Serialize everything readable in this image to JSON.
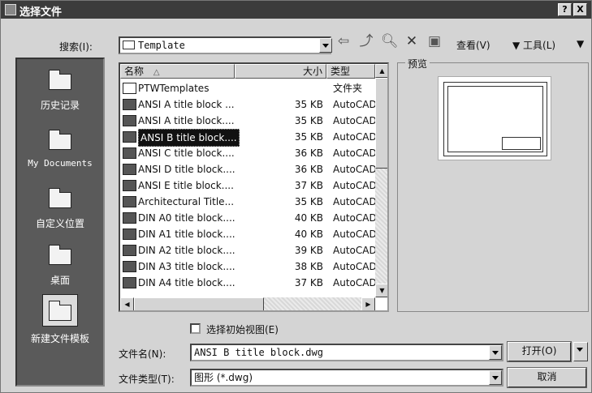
{
  "window": {
    "title": "选择文件",
    "help_button": "?",
    "close_button": "X"
  },
  "search": {
    "label": "搜索(I):",
    "value": "Template"
  },
  "toolbar": {
    "view_label": "查看(V)",
    "tools_label": "▼ 工具(L)",
    "tools_arrow": "▼"
  },
  "places": [
    {
      "label": "历史记录"
    },
    {
      "label": "My Documents"
    },
    {
      "label": "自定义位置"
    },
    {
      "label": "桌面"
    },
    {
      "label": "新建文件模板"
    }
  ],
  "filelist": {
    "headers": {
      "name": "名称",
      "sort_indicator": "△",
      "size": "大小",
      "type": "类型"
    },
    "rows": [
      {
        "name": "PTWTemplates",
        "size": "",
        "type": "文件夹"
      },
      {
        "name": "ANSI A title block ...",
        "size": "35 KB",
        "type": "AutoCAD"
      },
      {
        "name": "ANSI A title block....",
        "size": "35 KB",
        "type": "AutoCAD"
      },
      {
        "name": "ANSI B title block....",
        "size": "35 KB",
        "type": "AutoCAD"
      },
      {
        "name": "ANSI C title block....",
        "size": "36 KB",
        "type": "AutoCAD"
      },
      {
        "name": "ANSI D title block....",
        "size": "36 KB",
        "type": "AutoCAD"
      },
      {
        "name": "ANSI E title block....",
        "size": "37 KB",
        "type": "AutoCAD"
      },
      {
        "name": "Architectural Title...",
        "size": "35 KB",
        "type": "AutoCAD"
      },
      {
        "name": "DIN A0 title block....",
        "size": "40 KB",
        "type": "AutoCAD"
      },
      {
        "name": "DIN A1 title block....",
        "size": "40 KB",
        "type": "AutoCAD"
      },
      {
        "name": "DIN A2 title block....",
        "size": "39 KB",
        "type": "AutoCAD"
      },
      {
        "name": "DIN A3 title block....",
        "size": "38 KB",
        "type": "AutoCAD"
      },
      {
        "name": "DIN A4 title block....",
        "size": "37 KB",
        "type": "AutoCAD"
      }
    ]
  },
  "preview": {
    "label": "预览"
  },
  "bottom": {
    "initial_view_label": "选择初始视图(E)",
    "filename_label": "文件名(N):",
    "filename_value": "ANSI B title block.dwg",
    "filetype_label": "文件类型(T):",
    "filetype_value": "图形 (*.dwg)",
    "open_label": "打开(O)",
    "cancel_label": "取消"
  }
}
